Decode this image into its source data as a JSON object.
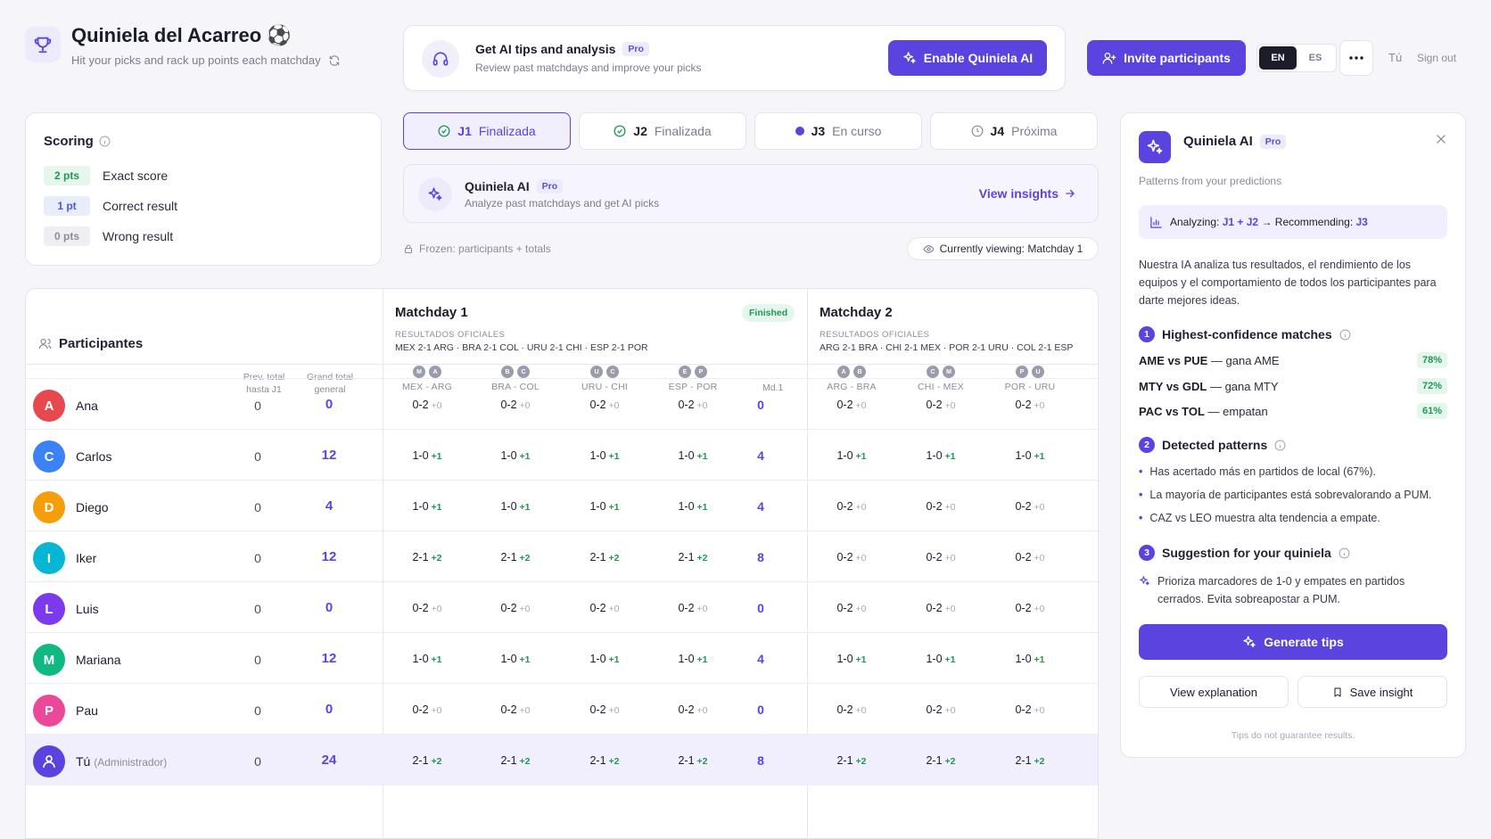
{
  "header": {
    "title": "Quiniela del Acarreo ⚽",
    "subtitle": "Hit your picks and rack up points each matchday",
    "ai_card": {
      "title": "Get AI tips and analysis",
      "badge": "Pro",
      "subtitle": "Review past matchdays and improve your picks",
      "button": "Enable Quiniela AI"
    },
    "invite_label": "Invite participants",
    "lang_en": "EN",
    "lang_es": "ES",
    "user": "Tú",
    "signout": "Sign out"
  },
  "scoring": {
    "title": "Scoring",
    "rows": [
      {
        "chip": "2 pts",
        "label": "Exact score"
      },
      {
        "chip": "1 pt",
        "label": "Correct result"
      },
      {
        "chip": "0 pts",
        "label": "Wrong result"
      }
    ]
  },
  "tabs": [
    {
      "code": "J1",
      "status": "Finalizada"
    },
    {
      "code": "J2",
      "status": "Finalizada"
    },
    {
      "code": "J3",
      "status": "En curso"
    },
    {
      "code": "J4",
      "status": "Próxima"
    }
  ],
  "mini_ai": {
    "title": "Quiniela AI",
    "badge": "Pro",
    "subtitle": "Analyze past matchdays and get AI picks",
    "link": "View insights"
  },
  "frozen": "Frozen: participants + totals",
  "viewing": "Currently viewing: Matchday 1",
  "table": {
    "participants_label": "Participantes",
    "prev_label": [
      "Prev. total",
      "hasta J1"
    ],
    "grand_label": [
      "Grand total",
      "general"
    ],
    "md1": {
      "title": "Matchday 1",
      "badge": "Finished",
      "official": "RESULTADOS OFICIALES",
      "results": "MEX 2-1 ARG · BRA 2-1 COL · URU 2-1 CHI · ESP 2-1 POR",
      "matches": [
        {
          "name": "MEX - ARG",
          "f1": "M",
          "f2": "A"
        },
        {
          "name": "BRA - COL",
          "f1": "B",
          "f2": "C"
        },
        {
          "name": "URU - CHI",
          "f1": "U",
          "f2": "C"
        },
        {
          "name": "ESP - POR",
          "f1": "E",
          "f2": "P"
        }
      ],
      "total_label": "Md.1"
    },
    "md2": {
      "title": "Matchday 2",
      "official": "RESULTADOS OFICIALES",
      "results": "ARG 2-1 BRA · CHI 2-1 MEX · POR 2-1 URU · COL 2-1 ESP",
      "matches": [
        {
          "name": "ARG - BRA",
          "f1": "A",
          "f2": "B"
        },
        {
          "name": "CHI - MEX",
          "f1": "C",
          "f2": "M"
        },
        {
          "name": "POR - URU",
          "f1": "P",
          "f2": "U"
        }
      ]
    },
    "rows": [
      {
        "initial": "A",
        "name": "Ana",
        "color": "#e5484d",
        "prev": "0",
        "grand": "0",
        "md1": [
          [
            "0-2",
            "+0"
          ],
          [
            "0-2",
            "+0"
          ],
          [
            "0-2",
            "+0"
          ],
          [
            "0-2",
            "+0"
          ]
        ],
        "md1_total": "0",
        "md2": [
          [
            "0-2",
            "+0"
          ],
          [
            "0-2",
            "+0"
          ],
          [
            "0-2",
            "+0"
          ]
        ]
      },
      {
        "initial": "C",
        "name": "Carlos",
        "color": "#3b82f6",
        "prev": "0",
        "grand": "12",
        "md1": [
          [
            "1-0",
            "+1"
          ],
          [
            "1-0",
            "+1"
          ],
          [
            "1-0",
            "+1"
          ],
          [
            "1-0",
            "+1"
          ]
        ],
        "md1_total": "4",
        "md2": [
          [
            "1-0",
            "+1"
          ],
          [
            "1-0",
            "+1"
          ],
          [
            "1-0",
            "+1"
          ]
        ]
      },
      {
        "initial": "D",
        "name": "Diego",
        "color": "#f59e0b",
        "prev": "0",
        "grand": "4",
        "md1": [
          [
            "1-0",
            "+1"
          ],
          [
            "1-0",
            "+1"
          ],
          [
            "1-0",
            "+1"
          ],
          [
            "1-0",
            "+1"
          ]
        ],
        "md1_total": "4",
        "md2": [
          [
            "0-2",
            "+0"
          ],
          [
            "0-2",
            "+0"
          ],
          [
            "0-2",
            "+0"
          ]
        ]
      },
      {
        "initial": "I",
        "name": "Iker",
        "color": "#06b6d4",
        "prev": "0",
        "grand": "12",
        "md1": [
          [
            "2-1",
            "+2"
          ],
          [
            "2-1",
            "+2"
          ],
          [
            "2-1",
            "+2"
          ],
          [
            "2-1",
            "+2"
          ]
        ],
        "md1_total": "8",
        "md2": [
          [
            "0-2",
            "+0"
          ],
          [
            "0-2",
            "+0"
          ],
          [
            "0-2",
            "+0"
          ]
        ]
      },
      {
        "initial": "L",
        "name": "Luis",
        "color": "#7c3aed",
        "prev": "0",
        "grand": "0",
        "md1": [
          [
            "0-2",
            "+0"
          ],
          [
            "0-2",
            "+0"
          ],
          [
            "0-2",
            "+0"
          ],
          [
            "0-2",
            "+0"
          ]
        ],
        "md1_total": "0",
        "md2": [
          [
            "0-2",
            "+0"
          ],
          [
            "0-2",
            "+0"
          ],
          [
            "0-2",
            "+0"
          ]
        ]
      },
      {
        "initial": "M",
        "name": "Mariana",
        "color": "#10b981",
        "prev": "0",
        "grand": "12",
        "md1": [
          [
            "1-0",
            "+1"
          ],
          [
            "1-0",
            "+1"
          ],
          [
            "1-0",
            "+1"
          ],
          [
            "1-0",
            "+1"
          ]
        ],
        "md1_total": "4",
        "md2": [
          [
            "1-0",
            "+1"
          ],
          [
            "1-0",
            "+1"
          ],
          [
            "1-0",
            "+1"
          ]
        ]
      },
      {
        "initial": "P",
        "name": "Pau",
        "color": "#ec4899",
        "prev": "0",
        "grand": "0",
        "md1": [
          [
            "0-2",
            "+0"
          ],
          [
            "0-2",
            "+0"
          ],
          [
            "0-2",
            "+0"
          ],
          [
            "0-2",
            "+0"
          ]
        ],
        "md1_total": "0",
        "md2": [
          [
            "0-2",
            "+0"
          ],
          [
            "0-2",
            "+0"
          ],
          [
            "0-2",
            "+0"
          ]
        ]
      },
      {
        "initial": "",
        "name": "Tú",
        "admin": "(Administrador)",
        "color": "#5b43e0",
        "prev": "0",
        "grand": "24",
        "md1": [
          [
            "2-1",
            "+2"
          ],
          [
            "2-1",
            "+2"
          ],
          [
            "2-1",
            "+2"
          ],
          [
            "2-1",
            "+2"
          ]
        ],
        "md1_total": "8",
        "md2": [
          [
            "2-1",
            "+2"
          ],
          [
            "2-1",
            "+2"
          ],
          [
            "2-1",
            "+2"
          ]
        ]
      }
    ]
  },
  "panel": {
    "title": "Quiniela AI",
    "badge": "Pro",
    "subtitle": "Patterns from your predictions",
    "analyzing_prefix": "Analyzing:",
    "analyzing_from": "J1 + J2",
    "analyzing_mid": "→ Recommending:",
    "analyzing_to": "J3",
    "intro": "Nuestra IA analiza tus resultados, el rendimiento de los equipos y el comportamiento de todos los participantes para darte mejores ideas.",
    "sec1": "Highest-confidence matches",
    "confidence": [
      {
        "match": "AME vs PUE",
        "pick": " — gana AME",
        "pct": "78%"
      },
      {
        "match": "MTY vs GDL",
        "pick": " — gana MTY",
        "pct": "72%"
      },
      {
        "match": "PAC vs TOL",
        "pick": " — empatan",
        "pct": "61%"
      }
    ],
    "sec2": "Detected patterns",
    "patterns": [
      "Has acertado más en partidos de local (67%).",
      "La mayoría de participantes está sobrevalorando a PUM.",
      "CAZ vs LEO muestra alta tendencia a empate."
    ],
    "sec3": "Suggestion for your quiniela",
    "suggestion": "Prioriza marcadores de 1-0 y empates en partidos cerrados. Evita sobreapostar a PUM.",
    "generate": "Generate tips",
    "explain": "View explanation",
    "save": "Save insight",
    "disclaimer": "Tips do not guarantee results."
  }
}
